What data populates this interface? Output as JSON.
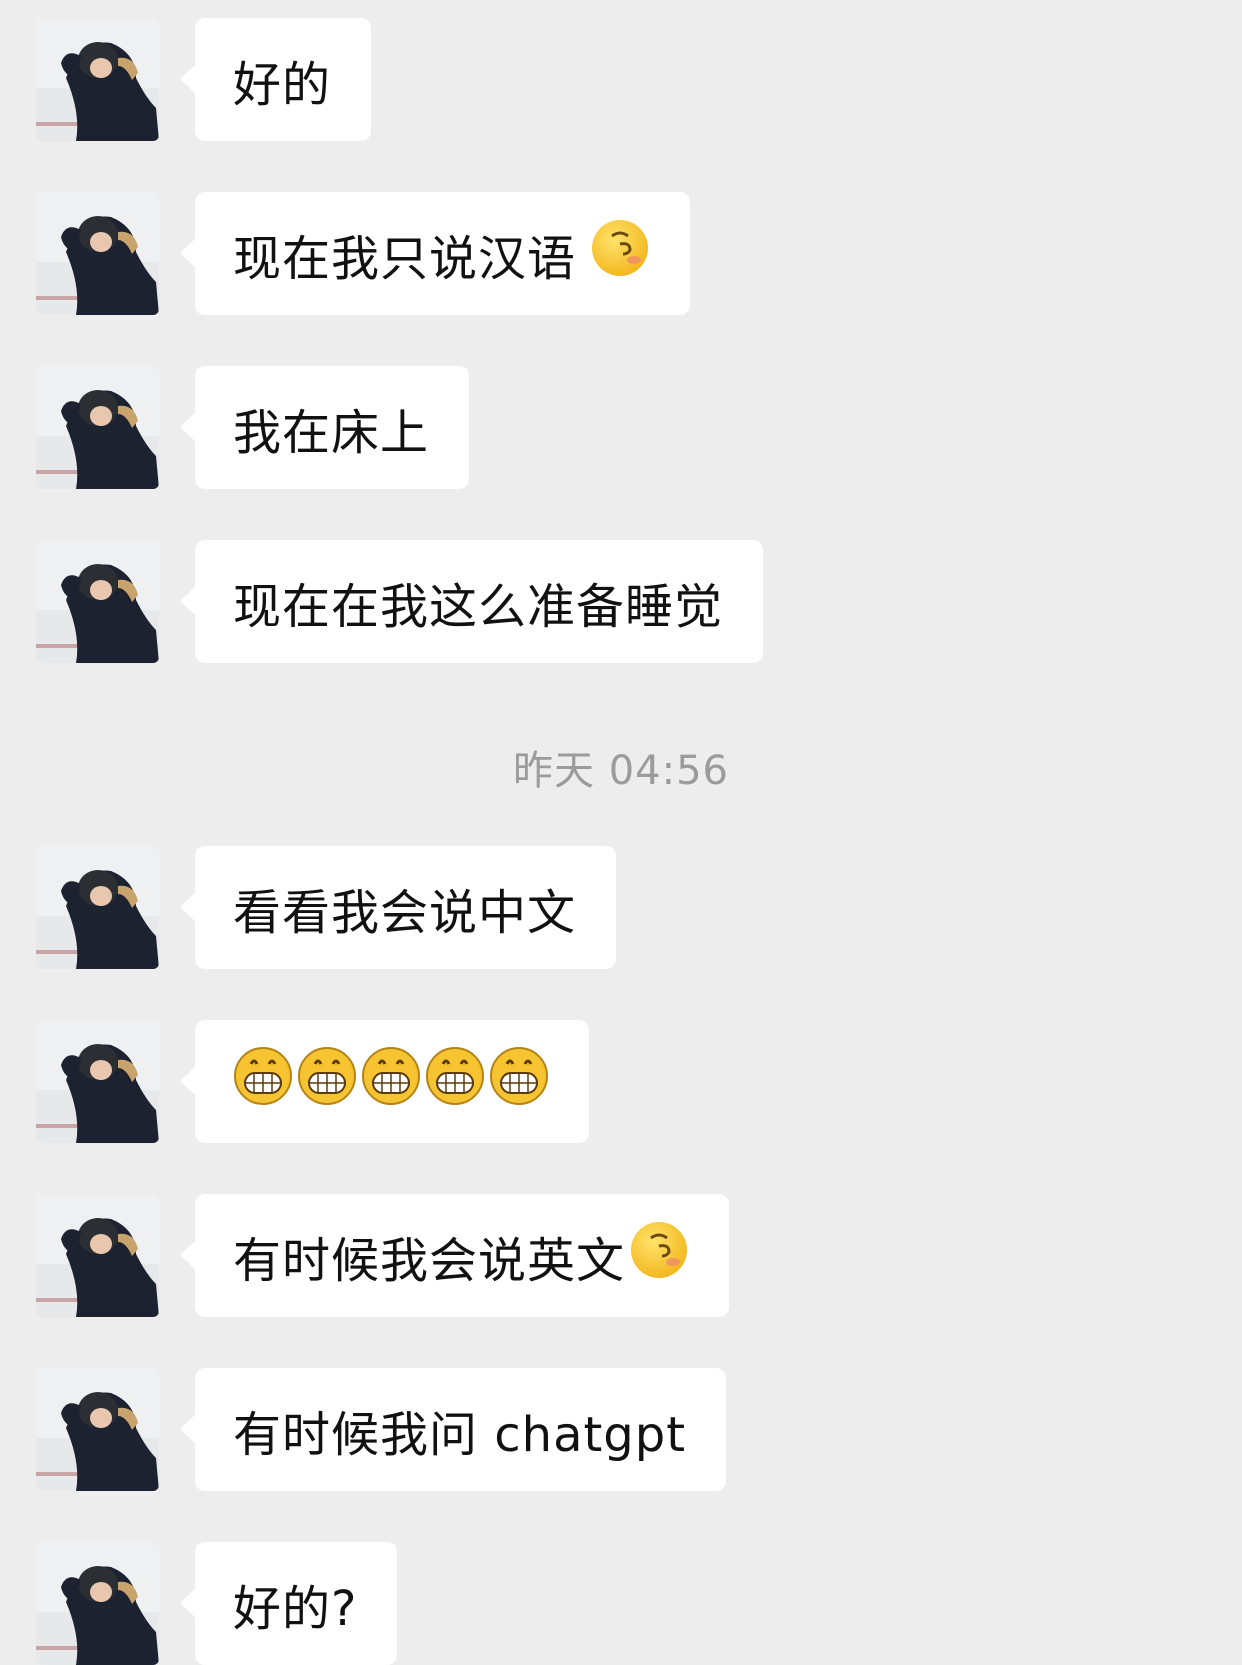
{
  "chat": {
    "messages": [
      {
        "text": "好的",
        "emoji": []
      },
      {
        "text": "现在我只说汉语",
        "emoji": [
          "wink-blush-emoji"
        ]
      },
      {
        "text": "我在床上",
        "emoji": []
      },
      {
        "text": "现在在我这么准备睡觉",
        "emoji": []
      },
      {
        "text": "看看我会说中文",
        "emoji": []
      },
      {
        "text": "",
        "emoji": [
          "grin-emoji",
          "grin-emoji",
          "grin-emoji",
          "grin-emoji",
          "grin-emoji"
        ]
      },
      {
        "text": "有时候我会说英文",
        "emoji": [
          "wink-blush-emoji"
        ]
      },
      {
        "text": "有时候我问 chatgpt",
        "emoji": []
      },
      {
        "text": "好的?",
        "emoji": []
      }
    ],
    "timestamp": "昨天 04:56"
  },
  "colors": {
    "background": "#ededed",
    "bubble": "#ffffff",
    "timestamp": "#9b9b9b"
  }
}
